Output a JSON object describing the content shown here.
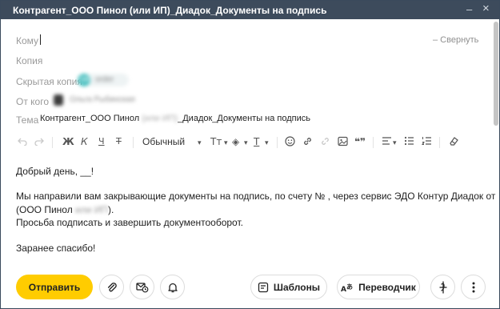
{
  "window": {
    "title": "Контрагент_ООО Пинол (или ИП)_Диадок_Документы на подпись",
    "minimize_glyph": "–",
    "close_glyph": "×"
  },
  "fields": {
    "to_label": "Кому",
    "collapse_label": "– Свернуть",
    "cc_label": "Копия",
    "bcc_label": "Скрытая копия",
    "bcc_chip_initials": "OR",
    "bcc_chip_text": "order",
    "from_label": "От кого",
    "from_value": "Ольга Рыбинская",
    "subject_label": "Тема",
    "subject_part1": "Контрагент_ООО Пинол ",
    "subject_blurred": "(или ИП)",
    "subject_part2": "_Диадок_Документы на подпись"
  },
  "toolbar": {
    "undo_icon": "undo-icon",
    "redo_icon": "redo-icon",
    "bold": "Ж",
    "italic": "К",
    "underline": "Ч",
    "strike": "Т",
    "style_select": "Обычный",
    "style_caret": "▾",
    "font_size": "Tт",
    "fill": "◈",
    "text_color": "T",
    "emoji_icon": "emoji-icon",
    "link_icon": "link-icon",
    "unlink_icon": "unlink-icon",
    "image_icon": "image-icon",
    "quote": "❝❞",
    "align_icon": "align-icon",
    "bullets_icon": "bulleted-list-icon",
    "numbered_icon": "numbered-list-icon",
    "clear_format_icon": "eraser-icon"
  },
  "body": {
    "greeting": "Добрый день, __!",
    "line1": "Мы направили вам закрывающие документы на подпись, по счету №  , через сервис ЭДО Контур Диадок от",
    "line2_part1": "(ООО Пинол ",
    "line2_blurred": "или ИП",
    "line2_part2": ").",
    "line3": "Просьба подписать и завершить документооборот.",
    "closing": "Заранее спасибо!"
  },
  "actions": {
    "send_label": "Отправить",
    "templates_label": "Шаблоны",
    "translator_label": "Переводчик",
    "attach_icon": "paperclip-icon",
    "delayed_send_icon": "scheduled-mail-icon",
    "reminder_icon": "bell-icon",
    "signature_icon": "signature-icon",
    "more_icon": "more-vertical-icon"
  },
  "colors": {
    "titlebar": "#3d4b5c",
    "send_button": "#ffcc00",
    "avatar": "#4cc1c1"
  }
}
